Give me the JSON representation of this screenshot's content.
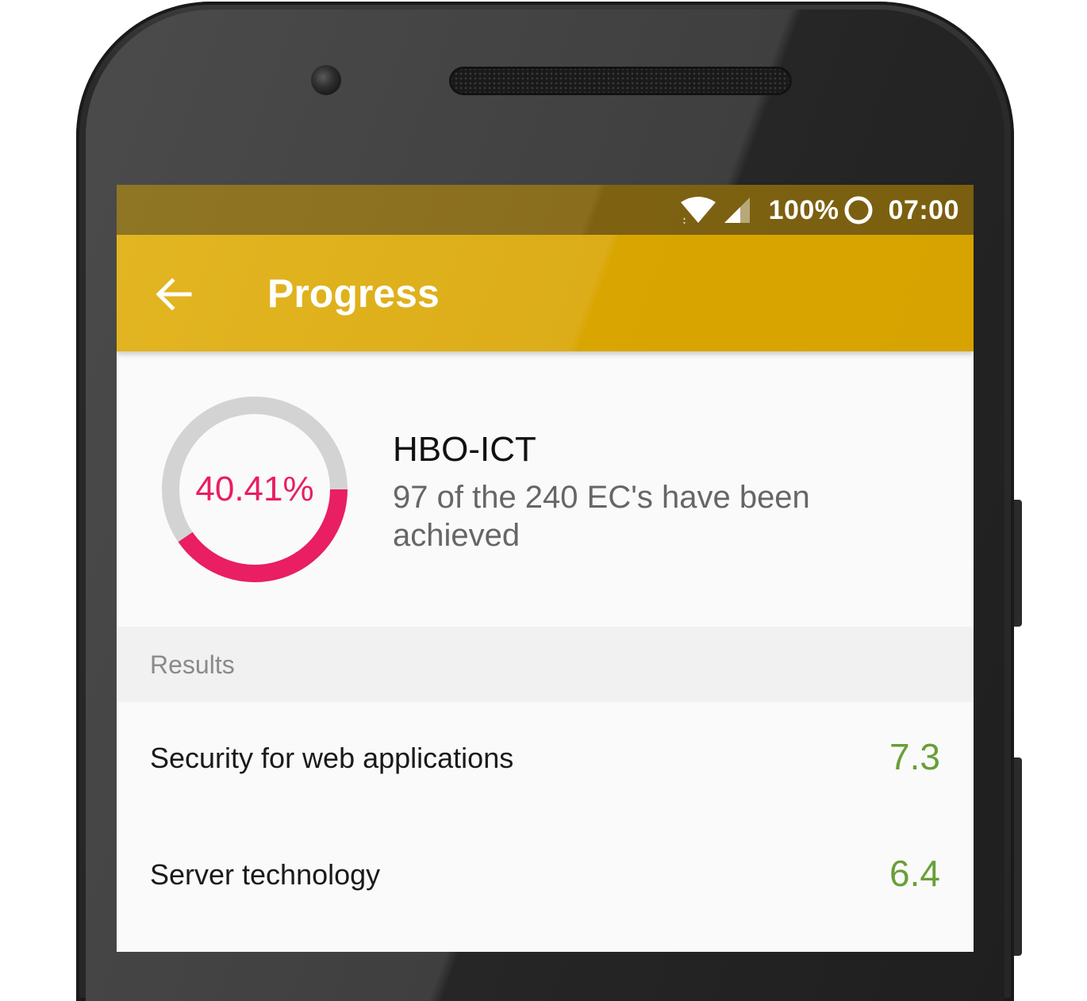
{
  "statusbar": {
    "battery": "100%",
    "time": "07:00",
    "icons": [
      "wifi-icon",
      "signal-icon",
      "battery-saver-icon"
    ]
  },
  "appbar": {
    "title": "Progress",
    "back_icon": "arrow-left-icon",
    "color": "#D9A500"
  },
  "summary": {
    "percent_label": "40.41%",
    "progress_fraction": 0.4041,
    "program": "HBO-ICT",
    "description": "97 of the 240 EC's have been achieved",
    "accent_color": "#E91E63",
    "track_color": "#D3D3D3"
  },
  "results": {
    "header": "Results",
    "items": [
      {
        "name": "Security for web applications",
        "grade": "7.3"
      },
      {
        "name": "Server technology",
        "grade": "6.4"
      }
    ],
    "grade_color": "#689F38"
  }
}
